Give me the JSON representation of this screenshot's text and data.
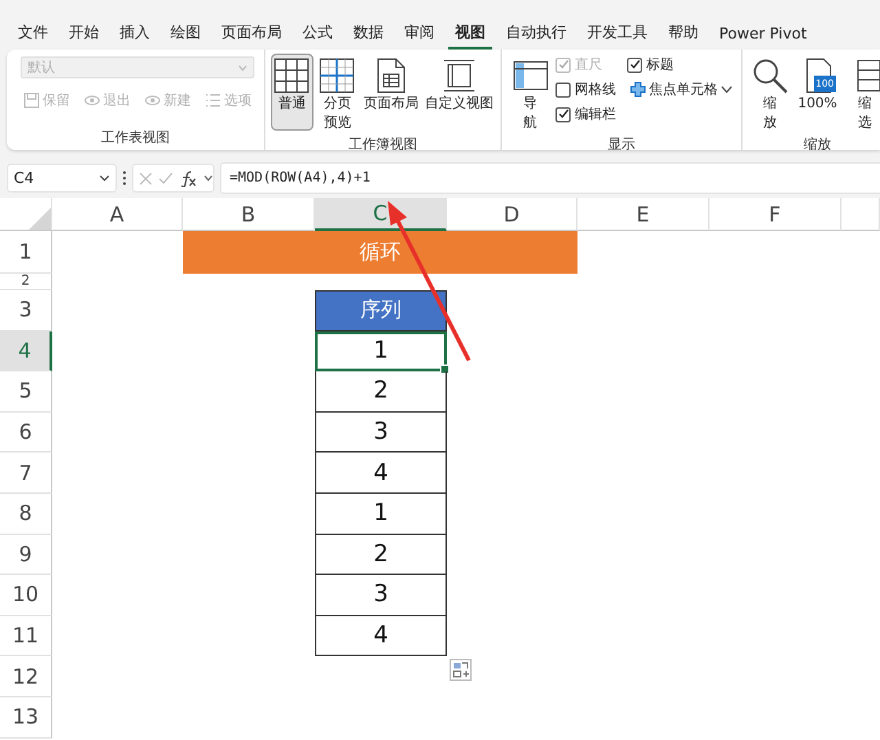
{
  "menu_tabs": [
    {
      "label": "文件",
      "selected": false
    },
    {
      "label": "开始",
      "selected": false
    },
    {
      "label": "插入",
      "selected": false
    },
    {
      "label": "绘图",
      "selected": false
    },
    {
      "label": "页面布局",
      "selected": false
    },
    {
      "label": "公式",
      "selected": false
    },
    {
      "label": "数据",
      "selected": false
    },
    {
      "label": "审阅",
      "selected": false
    },
    {
      "label": "视图",
      "selected": true
    },
    {
      "label": "自动执行",
      "selected": false
    },
    {
      "label": "开发工具",
      "selected": false
    },
    {
      "label": "帮助",
      "selected": false
    },
    {
      "label": "Power Pivot",
      "selected": false
    }
  ],
  "ribbon": {
    "groups": [
      {
        "kind": "sheet-view",
        "title": "工作表视图",
        "dropdown": {
          "placeholder": "默认",
          "disabled": true
        },
        "buttons": [
          {
            "label": "保留",
            "disabled": true
          },
          {
            "label": "退出",
            "disabled": true
          },
          {
            "label": "新建",
            "disabled": true
          },
          {
            "label": "选项",
            "disabled": true
          }
        ]
      },
      {
        "kind": "large-buttons",
        "title": "工作簿视图",
        "buttons": [
          {
            "lines": [
              "普通"
            ],
            "selected": true
          },
          {
            "lines": [
              "分页",
              "预览"
            ],
            "selected": false
          },
          {
            "lines": [
              "页面布局"
            ],
            "selected": false
          },
          {
            "lines": [
              "自定义视图"
            ],
            "selected": false
          }
        ]
      },
      {
        "kind": "show",
        "title": "显示",
        "nav_button": {
          "lines": [
            "导",
            "航"
          ]
        },
        "options": [
          {
            "kind": "checkbox",
            "label": "直尺",
            "checked": true,
            "disabled": true
          },
          {
            "kind": "checkbox",
            "label": "标题",
            "checked": true,
            "disabled": false
          },
          {
            "kind": "checkbox",
            "label": "网格线",
            "checked": false,
            "disabled": false
          },
          {
            "kind": "button",
            "label": "焦点单元格"
          },
          {
            "kind": "checkbox",
            "label": "编辑栏",
            "checked": true,
            "disabled": false
          }
        ]
      },
      {
        "kind": "large-buttons",
        "title": "缩放",
        "buttons": [
          {
            "lines": [
              "缩",
              "放"
            ],
            "selected": false
          },
          {
            "lines": [
              "100%"
            ],
            "badge": "100",
            "selected": false
          },
          {
            "lines": [
              "缩",
              "选"
            ],
            "selected": false
          }
        ]
      }
    ]
  },
  "formula_bar": {
    "name_box": "C4",
    "formula": "=MOD(ROW(A4),4)+1"
  },
  "sheet": {
    "columns": [
      {
        "label": "A"
      },
      {
        "label": "B"
      },
      {
        "label": "C"
      },
      {
        "label": "D"
      },
      {
        "label": "E"
      },
      {
        "label": "F"
      }
    ],
    "rows": [
      {
        "label": "1"
      },
      {
        "label": "2"
      },
      {
        "label": "3"
      },
      {
        "label": "4"
      },
      {
        "label": "5"
      },
      {
        "label": "6"
      },
      {
        "label": "7"
      },
      {
        "label": "8"
      },
      {
        "label": "9"
      },
      {
        "label": "10"
      },
      {
        "label": "11"
      },
      {
        "label": "12"
      },
      {
        "label": "13"
      }
    ],
    "title_band": {
      "text": "循环"
    },
    "sequence": {
      "header": "序列",
      "values": [
        {
          "text": "1",
          "selected": true
        },
        {
          "text": "2",
          "selected": false
        },
        {
          "text": "3",
          "selected": false
        },
        {
          "text": "4",
          "selected": false
        },
        {
          "text": "1",
          "selected": false
        },
        {
          "text": "2",
          "selected": false
        },
        {
          "text": "3",
          "selected": false
        },
        {
          "text": "4",
          "selected": false
        }
      ]
    }
  }
}
